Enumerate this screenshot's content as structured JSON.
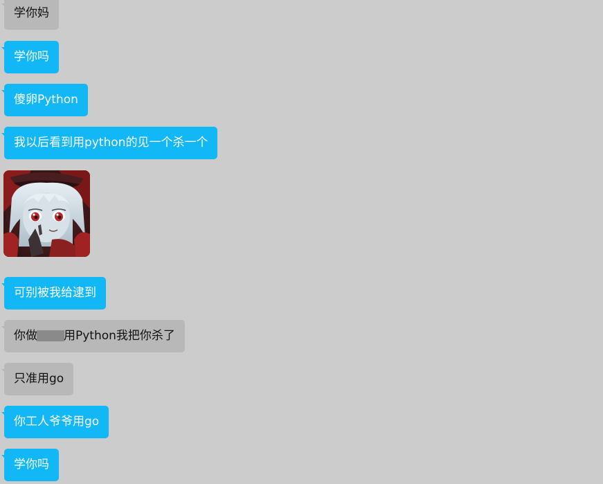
{
  "messages": [
    {
      "text": "学你妈",
      "style": "gray"
    },
    {
      "text": "学你吗",
      "style": "blue"
    },
    {
      "text": "傻卵Python",
      "style": "blue"
    },
    {
      "text": "我以后看到用python的见一个杀一个",
      "style": "blue"
    },
    {
      "image": "anime-girl-sticker"
    },
    {
      "text": "可别被我给逮到",
      "style": "blue"
    },
    {
      "text_before": "你做",
      "text_after": "用Python我把你杀了",
      "style": "gray",
      "redacted": true
    },
    {
      "text": "只准用go",
      "style": "gray"
    },
    {
      "text": "你工人爷爷用go",
      "style": "blue"
    },
    {
      "text": "学你吗",
      "style": "blue"
    }
  ],
  "colors": {
    "background": "#cccccc",
    "bubble_blue": "#12b7f5",
    "bubble_gray": "#b8b8b8"
  }
}
